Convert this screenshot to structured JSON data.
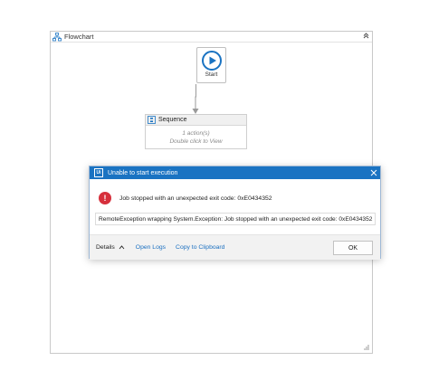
{
  "designer": {
    "title": "Flowchart",
    "collapse_glyph": "⌃"
  },
  "flowchart": {
    "start_label": "Start",
    "sequence": {
      "title": "Sequence",
      "actions_text": "1 action(s)",
      "hint_text": "Double click to View"
    }
  },
  "dialog": {
    "app_icon_text": "Ui",
    "title": "Unable to start execution",
    "error_glyph": "!",
    "message": "Job stopped with an unexpected exit code: 0xE0434352",
    "details_text": "RemoteException wrapping System.Exception: Job stopped with an unexpected exit code: 0xE0434352",
    "footer": {
      "details_label": "Details",
      "open_logs_label": "Open Logs",
      "copy_label": "Copy to Clipboard",
      "ok_label": "OK"
    }
  },
  "colors": {
    "title_bar": "#1a73c2",
    "error": "#d6303c",
    "link": "#1a6fc0",
    "start_play": "#1a73c2"
  }
}
